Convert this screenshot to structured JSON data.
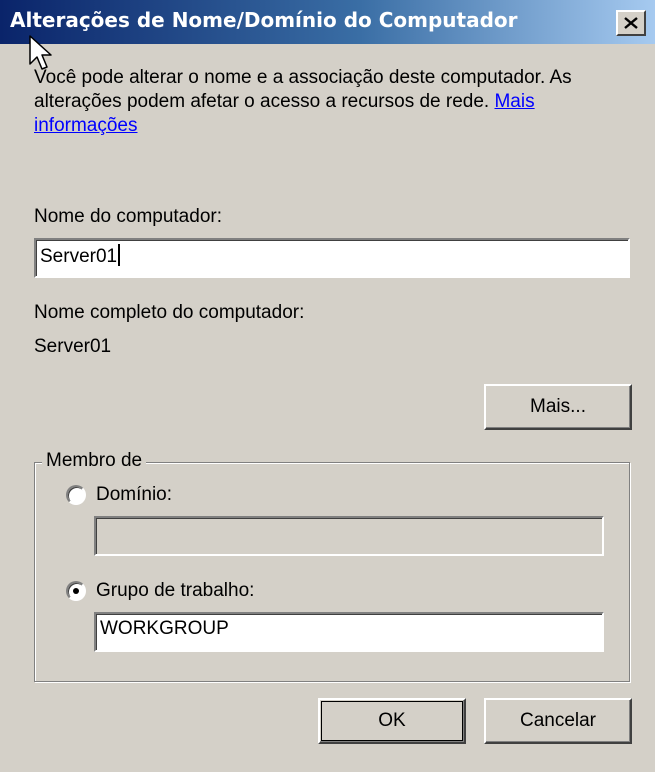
{
  "window": {
    "title": "Alterações de Nome/Domínio do Computador",
    "close_icon": "close-icon"
  },
  "description": {
    "text": "Você pode alterar o nome e a associação deste computador. As alterações podem afetar o acesso a recursos de rede.",
    "link": "Mais informações"
  },
  "computer_name": {
    "label": "Nome do computador:",
    "value": "Server01"
  },
  "full_name": {
    "label": "Nome completo do computador:",
    "value": "Server01"
  },
  "more_button": "Mais...",
  "member_of": {
    "legend": "Membro de",
    "domain_label": "Domínio:",
    "domain_value": "",
    "domain_selected": false,
    "workgroup_label": "Grupo de trabalho:",
    "workgroup_value": "WORKGROUP",
    "workgroup_selected": true
  },
  "buttons": {
    "ok": "OK",
    "cancel": "Cancelar"
  }
}
